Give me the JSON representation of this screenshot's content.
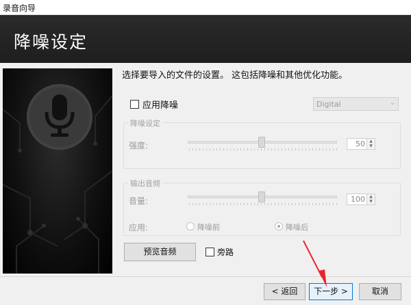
{
  "window": {
    "title": "录音向导"
  },
  "banner": {
    "title": "降噪设定"
  },
  "intro": "选择要导入的文件的设置。 这包括降噪和其他优化功能。",
  "noise_reduction": {
    "label": "应用降噪",
    "checked": false,
    "mode": "Digital"
  },
  "noise_group": {
    "title": "降噪设定",
    "strength_label": "强度:",
    "strength_value": "50",
    "strength_level": 50
  },
  "output_group": {
    "title": "输出音频",
    "volume_label": "音量:",
    "volume_value": "100",
    "volume_level": 50,
    "apply_label": "应用:",
    "options": [
      {
        "label": "降噪前",
        "selected": false
      },
      {
        "label": "降噪后",
        "selected": true
      }
    ]
  },
  "preview_button": "预览音频",
  "bypass": {
    "label": "旁路",
    "checked": false
  },
  "buttons": {
    "back": "< 返回",
    "next": "下一步 >",
    "cancel": "取消"
  },
  "colors": {
    "accent": "#0078d7",
    "banner": "#222222",
    "annotation": "#e8252b"
  }
}
